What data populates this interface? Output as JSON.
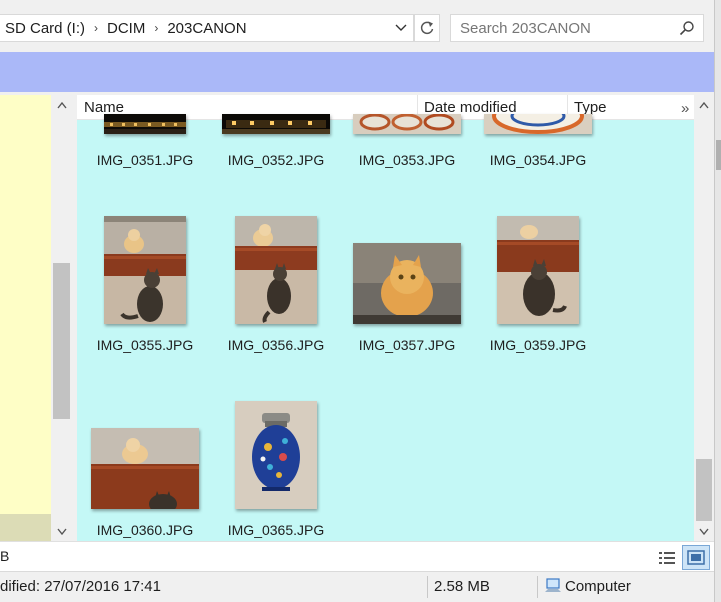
{
  "colors": {
    "toolbar_bg": "#aab8f8",
    "nav_bg": "#fefec6",
    "nav_bottom_bg": "#dcdcb6",
    "file_pane_bg": "#c4f8f6"
  },
  "address": {
    "crumbs": [
      "SD Card (I:)",
      "DCIM",
      "203CANON"
    ],
    "separator": "›",
    "dropdown_icon": "chevron-down-icon",
    "refresh_icon": "refresh-icon"
  },
  "search": {
    "placeholder": "Search 203CANON",
    "icon": "search-icon"
  },
  "columns": {
    "name": "Name",
    "date_modified": "Date modified",
    "type": "Type",
    "more": "»",
    "sort_caret": "^"
  },
  "files": [
    {
      "name": "IMG_0351.JPG",
      "subject": "night-building"
    },
    {
      "name": "IMG_0352.JPG",
      "subject": "night-building"
    },
    {
      "name": "IMG_0353.JPG",
      "subject": "plates"
    },
    {
      "name": "IMG_0354.JPG",
      "subject": "plate"
    },
    {
      "name": "IMG_0355.JPG",
      "subject": "cats-window"
    },
    {
      "name": "IMG_0356.JPG",
      "subject": "cats-window"
    },
    {
      "name": "IMG_0357.JPG",
      "subject": "ginger-cat"
    },
    {
      "name": "IMG_0359.JPG",
      "subject": "cats-window"
    },
    {
      "name": "IMG_0360.JPG",
      "subject": "cats-window-wide"
    },
    {
      "name": "IMG_0365.JPG",
      "subject": "blue-vase"
    }
  ],
  "details": {
    "fragment": "B"
  },
  "status": {
    "modified": "dified: 27/07/2016 17:41",
    "size": "2.58 MB",
    "location": "Computer",
    "location_icon": "computer-icon"
  }
}
